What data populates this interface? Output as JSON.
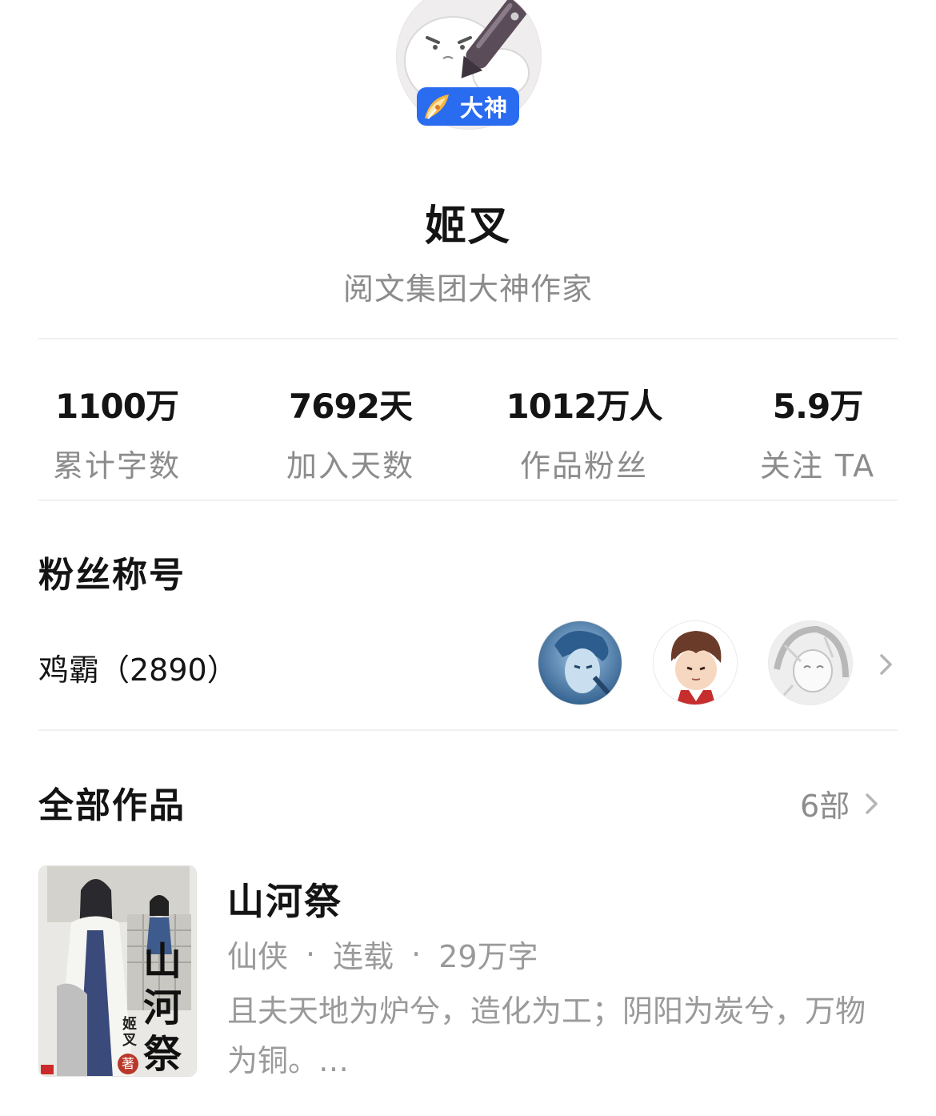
{
  "author": {
    "badge_label": "大神",
    "name": "姬叉",
    "title": "阅文集团大神作家"
  },
  "stats": [
    {
      "value": "1100万",
      "label": "累计字数"
    },
    {
      "value": "7692天",
      "label": "加入天数"
    },
    {
      "value": "1012万人",
      "label": "作品粉丝"
    },
    {
      "value": "5.9万",
      "label": "关注 TA"
    }
  ],
  "fan_section": {
    "title": "粉丝称号",
    "fan_title": "鸡霸（2890）",
    "avatars": [
      "fan-avatar-blue-portrait",
      "fan-avatar-anime-boy",
      "fan-avatar-manga-sketch"
    ]
  },
  "works_section": {
    "title": "全部作品",
    "count": "6部"
  },
  "book": {
    "title": "山河祭",
    "genre": "仙侠",
    "status": "连载",
    "word_count": "29万字",
    "separator": "·",
    "description": "且夫天地为炉兮，造化为工；阴阳为炭兮，万物为铜。…",
    "cover_text": "山河祭",
    "cover_author": "姬叉",
    "cover_author_suffix": "著"
  },
  "colors": {
    "badge_blue": "#2a6cf0",
    "text_primary": "#141414",
    "text_secondary": "#8c8c8c",
    "divider": "#f0f0f0"
  }
}
